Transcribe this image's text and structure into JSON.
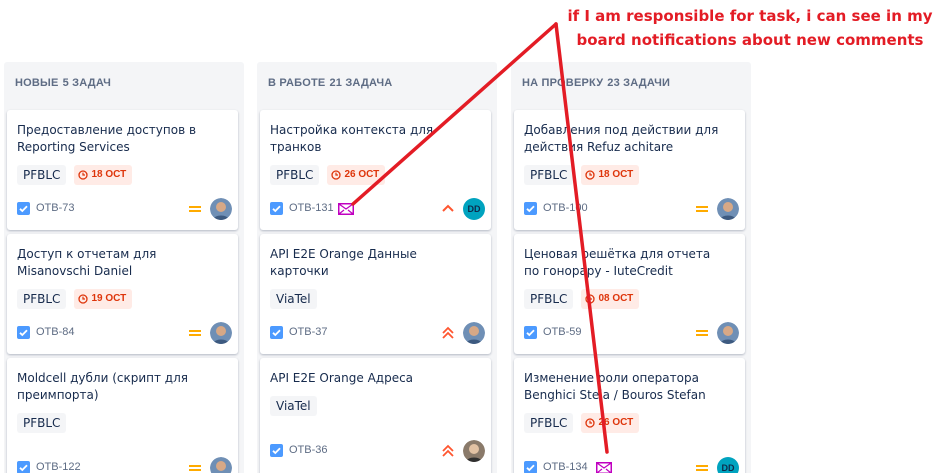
{
  "annotation": {
    "line1": "if I am responsible for task, i can see in my",
    "line2": "board notifications about new comments",
    "color": "#e31c25"
  },
  "colors": {
    "due_bg": "#ffebe6",
    "due_text": "#de350b",
    "priority_medium": "#ffab00",
    "priority_high": "#ff5630",
    "mail_icon": "#c000c0",
    "check": "#4c9aff"
  },
  "columns": [
    {
      "title": "НОВЫЕ",
      "count": "5 ЗАДАЧ",
      "cards": [
        {
          "title": "Предоставление доступов в Reporting Services",
          "tag": "PFBLC",
          "due": "18 ОСТ",
          "key": "ОТВ-73",
          "priority": "medium",
          "assignee": "avatar"
        },
        {
          "title": "Доступ к отчетам для Misanovschi Daniel",
          "tag": "PFBLC",
          "due": "19 ОСТ",
          "key": "ОТВ-84",
          "priority": "medium",
          "assignee": "avatar"
        },
        {
          "title": "Moldcell дубли (скрипт для преимпорта)",
          "tag": "PFBLC",
          "due": "",
          "key": "ОТВ-122",
          "priority": "medium",
          "assignee": "avatar"
        }
      ]
    },
    {
      "title": "В РАБОТЕ",
      "count": "21 ЗАДАЧА",
      "cards": [
        {
          "title": "Настройка контекста для транков",
          "tag": "PFBLC",
          "due": "26 ОСТ",
          "key": "ОТВ-131",
          "priority": "high",
          "assignee": "DD",
          "notification": "mail-icon"
        },
        {
          "title": "API E2E Orange Данные карточки",
          "tag": "ViaTel",
          "due": "",
          "key": "ОТВ-37",
          "priority": "highest",
          "assignee": "avatar"
        },
        {
          "title": "API E2E Orange Адреса",
          "tag": "ViaTel",
          "due": "",
          "key": "ОТВ-36",
          "priority": "highest",
          "assignee": "avatar"
        }
      ]
    },
    {
      "title": "НА ПРОВЕРКУ",
      "count": "23 ЗАДАЧИ",
      "cards": [
        {
          "title": "Добавления под действии для действия Refuz achitare",
          "tag": "PFBLC",
          "due": "18 ОСТ",
          "key": "ОТВ-100",
          "priority": "medium",
          "assignee": "avatar"
        },
        {
          "title": "Ценовая решётка для отчета по гонорару - IuteCredit",
          "tag": "PFBLC",
          "due": "08 ОСТ",
          "key": "ОТВ-59",
          "priority": "medium",
          "assignee": "avatar"
        },
        {
          "title": "Изменение роли оператора Benghici Stela / Bouros Stefan",
          "tag": "PFBLC",
          "due": "26 ОСТ",
          "key": "ОТВ-134",
          "priority": "medium",
          "assignee": "DD",
          "notification": "mail-icon"
        }
      ]
    }
  ]
}
